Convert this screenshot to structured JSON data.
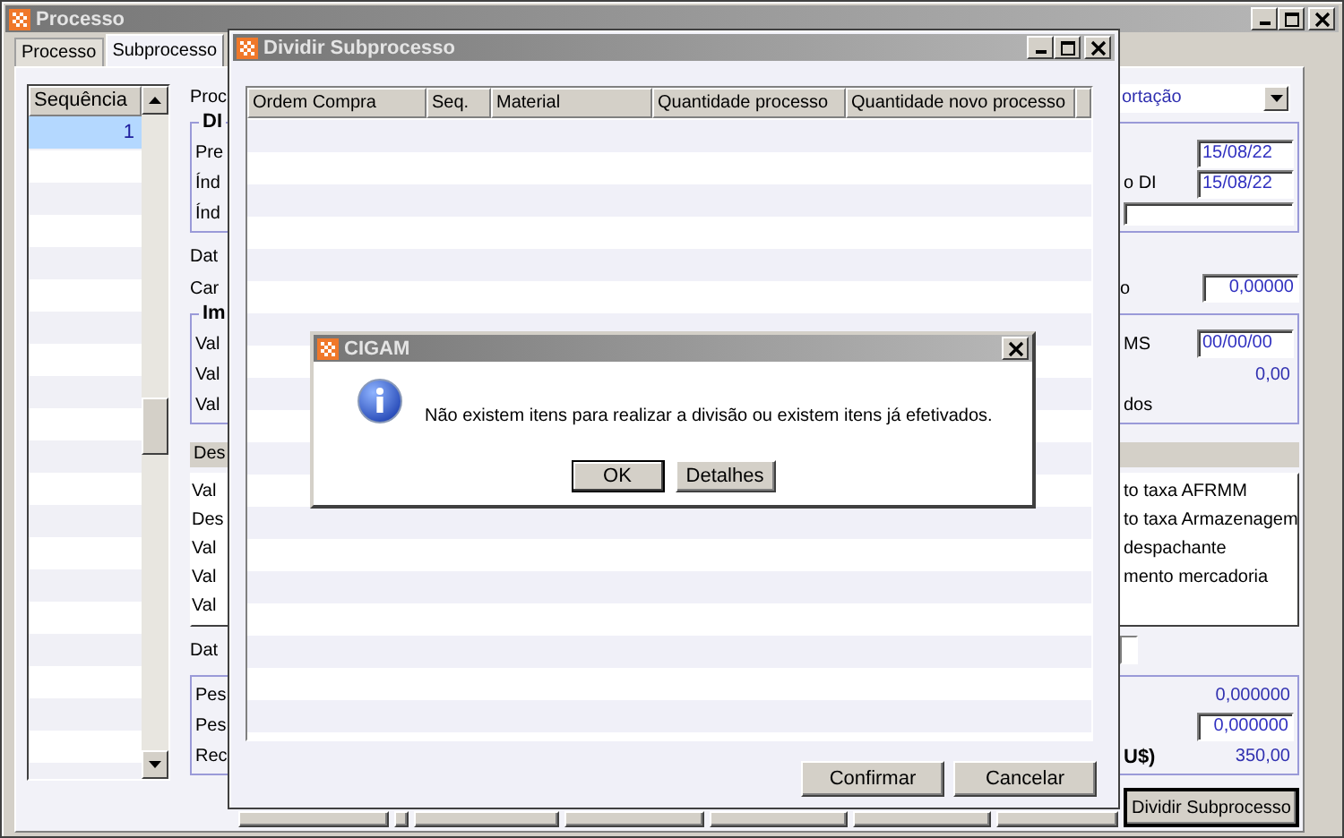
{
  "main_window": {
    "title": "Processo",
    "tabs": [
      {
        "label": "Processo",
        "selected": false
      },
      {
        "label": "Subprocesso",
        "selected": true
      }
    ],
    "sequence_list": {
      "header": "Sequência",
      "rows": [
        {
          "value": "1",
          "selected": true
        }
      ]
    },
    "form": [
      {
        "kind": "row",
        "left": "Proc",
        "right": [
          {
            "kind": "combo",
            "value": "ortação"
          }
        ]
      },
      {
        "kind": "group",
        "title": "DI",
        "rows": [
          {
            "left": "Pre",
            "right": [
              {
                "kind": "date_field",
                "value": "15/08/22"
              }
            ]
          },
          {
            "left": "Índ",
            "right": [
              {
                "kind": "label",
                "text": "o DI"
              },
              {
                "kind": "date_field",
                "value": "15/08/22"
              }
            ]
          },
          {
            "left": "Índ",
            "right": [
              {
                "kind": "wide_field"
              }
            ]
          }
        ]
      },
      {
        "kind": "row",
        "left": "Dat"
      },
      {
        "kind": "row",
        "left": "Car",
        "right": [
          {
            "kind": "label",
            "text": "o"
          },
          {
            "kind": "number_field",
            "value": "0,00000"
          }
        ]
      },
      {
        "kind": "group",
        "title": "Im",
        "rows": [
          {
            "left": "Val",
            "right": [
              {
                "kind": "label",
                "text": "MS"
              },
              {
                "kind": "date_field",
                "value": "00/00/00"
              }
            ]
          },
          {
            "left": "Val",
            "right": [
              {
                "kind": "value",
                "text": "0,00"
              }
            ]
          },
          {
            "left": "Val",
            "right": [
              {
                "kind": "label",
                "text": "dos"
              }
            ]
          }
        ]
      },
      {
        "kind": "panel",
        "title": "Des",
        "rows": [
          {
            "left": "Val",
            "right": [
              {
                "kind": "label",
                "text": "to taxa AFRMM"
              }
            ]
          },
          {
            "left": "Des",
            "right": [
              {
                "kind": "label",
                "text": "to taxa Armazenagem"
              }
            ]
          },
          {
            "left": "Val",
            "right": [
              {
                "kind": "label",
                "text": "despachante"
              }
            ]
          },
          {
            "left": "Val",
            "right": [
              {
                "kind": "label",
                "text": "mento mercadoria"
              }
            ]
          },
          {
            "left": "Val"
          }
        ]
      },
      {
        "kind": "row",
        "left": "Dat",
        "right": [
          {
            "kind": "small_field"
          }
        ]
      },
      {
        "kind": "group",
        "rows": [
          {
            "left": "Pes",
            "right": [
              {
                "kind": "value",
                "text": "0,000000"
              }
            ]
          },
          {
            "left": "Pes",
            "right": [
              {
                "kind": "number_field",
                "value": "0,000000"
              }
            ]
          },
          {
            "left": "Rec",
            "right": [
              {
                "kind": "bold_label",
                "text": "U$)"
              },
              {
                "kind": "value",
                "text": "350,00"
              }
            ]
          }
        ]
      }
    ],
    "bottom_buttons": [
      {
        "kind": "covered"
      },
      {
        "kind": "covered"
      },
      {
        "kind": "covered"
      },
      {
        "kind": "covered"
      },
      {
        "kind": "covered"
      },
      {
        "kind": "covered"
      },
      {
        "kind": "covered"
      },
      {
        "kind": "button",
        "label": "Dividir Subprocesso"
      }
    ]
  },
  "split_dialog": {
    "title": "Dividir Subprocesso",
    "columns": [
      "Ordem Compra",
      "Seq.",
      "Material",
      "Quantidade processo",
      "Quantidade novo processo"
    ],
    "buttons": [
      "Confirmar",
      "Cancelar"
    ]
  },
  "message_box": {
    "title": "CIGAM",
    "message": "Não existem itens para realizar a divisão ou existem itens já efetivados.",
    "buttons": [
      {
        "label": "OK",
        "focused": true
      },
      {
        "label": "Detalhes",
        "focused": false
      }
    ]
  }
}
